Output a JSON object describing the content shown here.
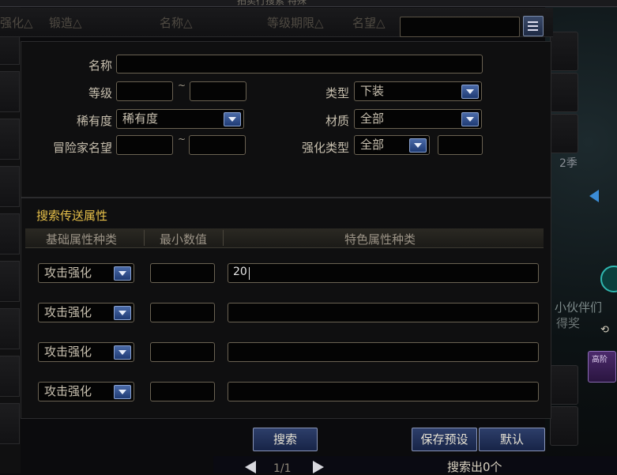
{
  "window": {
    "title": "拍卖行搜索 特殊"
  },
  "columns": [
    "强化△",
    "锻造△",
    "名称△",
    "等级期限△",
    "名望△"
  ],
  "filters": {
    "name_label": "名称",
    "level_label": "等级",
    "level_tilde": "~",
    "rarity_label": "稀有度",
    "rarity_value": "稀有度",
    "renown_label": "冒险家名望",
    "renown_tilde": "~",
    "type_label": "类型",
    "type_value": "下装",
    "material_label": "材质",
    "material_value": "全部",
    "enhance_type_label": "强化类型",
    "enhance_type_value": "全部"
  },
  "attributes": {
    "section_title": "搜索传送属性",
    "headers": [
      "基础属性种类",
      "最小数值",
      "特色属性种类"
    ],
    "rows": [
      {
        "kind": "攻击强化",
        "min": "",
        "special": "20"
      },
      {
        "kind": "攻击强化",
        "min": "",
        "special": ""
      },
      {
        "kind": "攻击强化",
        "min": "",
        "special": ""
      },
      {
        "kind": "攻击强化",
        "min": "",
        "special": ""
      }
    ]
  },
  "buttons": {
    "search": "搜索",
    "save_preset": "保存预设",
    "default": "默认"
  },
  "footer": {
    "page": "1/1",
    "result": "搜索出0个"
  },
  "scene_text": {
    "season": "2季",
    "companion": "小伙伴们",
    "obtain": "得奖",
    "badge": "高阶"
  },
  "colors": {
    "accent_gold": "#e8c14a",
    "button_blue": "#2d3e6a"
  }
}
